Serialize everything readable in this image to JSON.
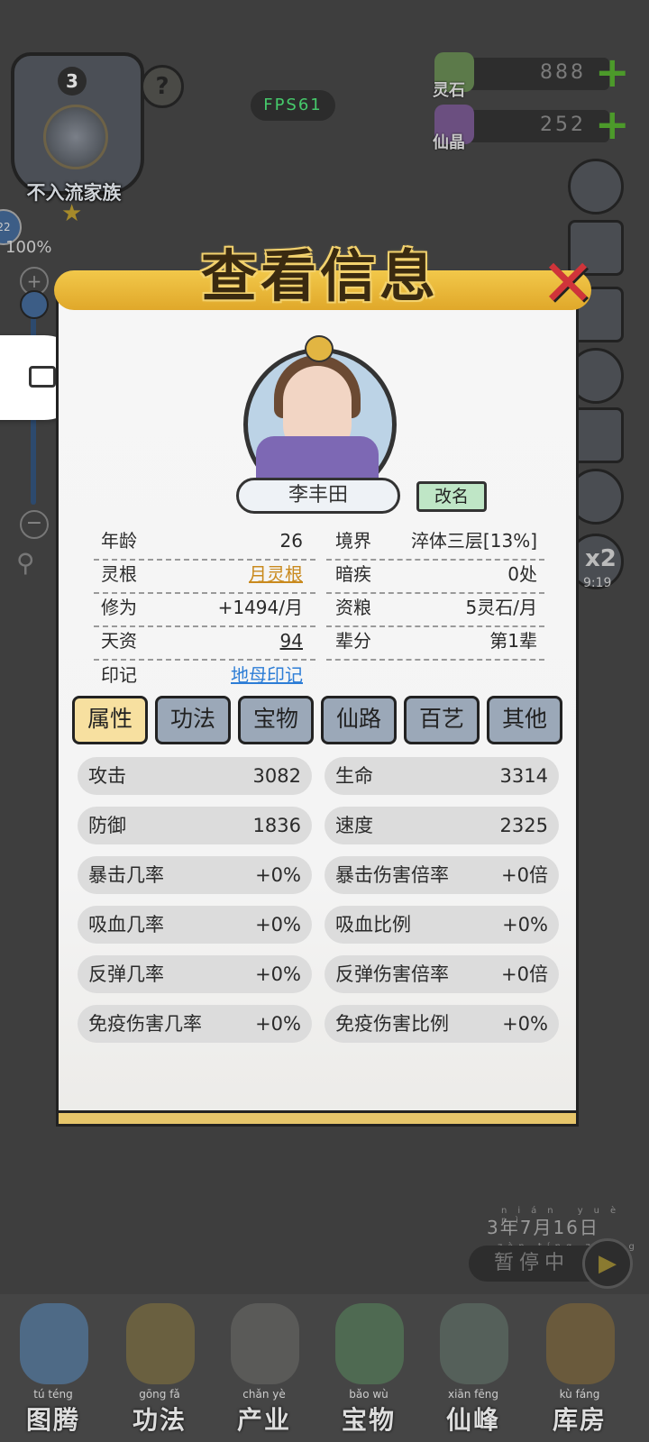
{
  "family": {
    "rank": "3",
    "name": "不入流家族"
  },
  "fps": "FPS61",
  "currencies": [
    {
      "label": "灵石",
      "value": "888"
    },
    {
      "label": "仙晶",
      "value": "252"
    }
  ],
  "left": {
    "percent": "100%",
    "badge": "22"
  },
  "side_badge": {
    "multiplier": "x2",
    "timer": "9:19"
  },
  "panel": {
    "title": "查看信息",
    "character_name": "李丰田",
    "rename_label": "改名",
    "info": {
      "left": [
        {
          "label": "年龄",
          "value": "26"
        },
        {
          "label": "灵根",
          "value": "月灵根"
        },
        {
          "label": "修为",
          "value": "+1494/月"
        },
        {
          "label": "天资",
          "value": "94"
        },
        {
          "label": "印记",
          "value": "地母印记"
        }
      ],
      "right": [
        {
          "label": "境界",
          "value": "淬体三层[13%]"
        },
        {
          "label": "暗疾",
          "value": "0处"
        },
        {
          "label": "资粮",
          "value": "5灵石/月"
        },
        {
          "label": "辈分",
          "value": "第1辈"
        }
      ]
    },
    "tabs": [
      "属性",
      "功法",
      "宝物",
      "仙路",
      "百艺",
      "其他"
    ],
    "active_tab": "属性",
    "stats": [
      {
        "label": "攻击",
        "value": "3082"
      },
      {
        "label": "生命",
        "value": "3314"
      },
      {
        "label": "防御",
        "value": "1836"
      },
      {
        "label": "速度",
        "value": "2325"
      },
      {
        "label": "暴击几率",
        "value": "+0%"
      },
      {
        "label": "暴击伤害倍率",
        "value": "+0倍"
      },
      {
        "label": "吸血几率",
        "value": "+0%"
      },
      {
        "label": "吸血比例",
        "value": "+0%"
      },
      {
        "label": "反弹几率",
        "value": "+0%"
      },
      {
        "label": "反弹伤害倍率",
        "value": "+0倍"
      },
      {
        "label": "免疫伤害几率",
        "value": "+0%"
      },
      {
        "label": "免疫伤害比例",
        "value": "+0%"
      }
    ]
  },
  "date": "3年7月16日",
  "date_pinyin": "nián yuè rì",
  "pause": {
    "label": "暂停中",
    "pinyin": "zàn tíng zhōng"
  },
  "nav": [
    {
      "label": "图腾",
      "pinyin": "tú téng"
    },
    {
      "label": "功法",
      "pinyin": "gōng fǎ"
    },
    {
      "label": "产业",
      "pinyin": "chǎn yè"
    },
    {
      "label": "宝物",
      "pinyin": "bǎo wù"
    },
    {
      "label": "仙峰",
      "pinyin": "xiān fēng"
    },
    {
      "label": "库房",
      "pinyin": "kù fáng"
    }
  ],
  "colors": {
    "accent_gold": "#e0a82a",
    "link_orange": "#c98a1e",
    "link_blue": "#2d7dd6",
    "close_red": "#d0343a",
    "plus_green": "#4c9a2a"
  }
}
